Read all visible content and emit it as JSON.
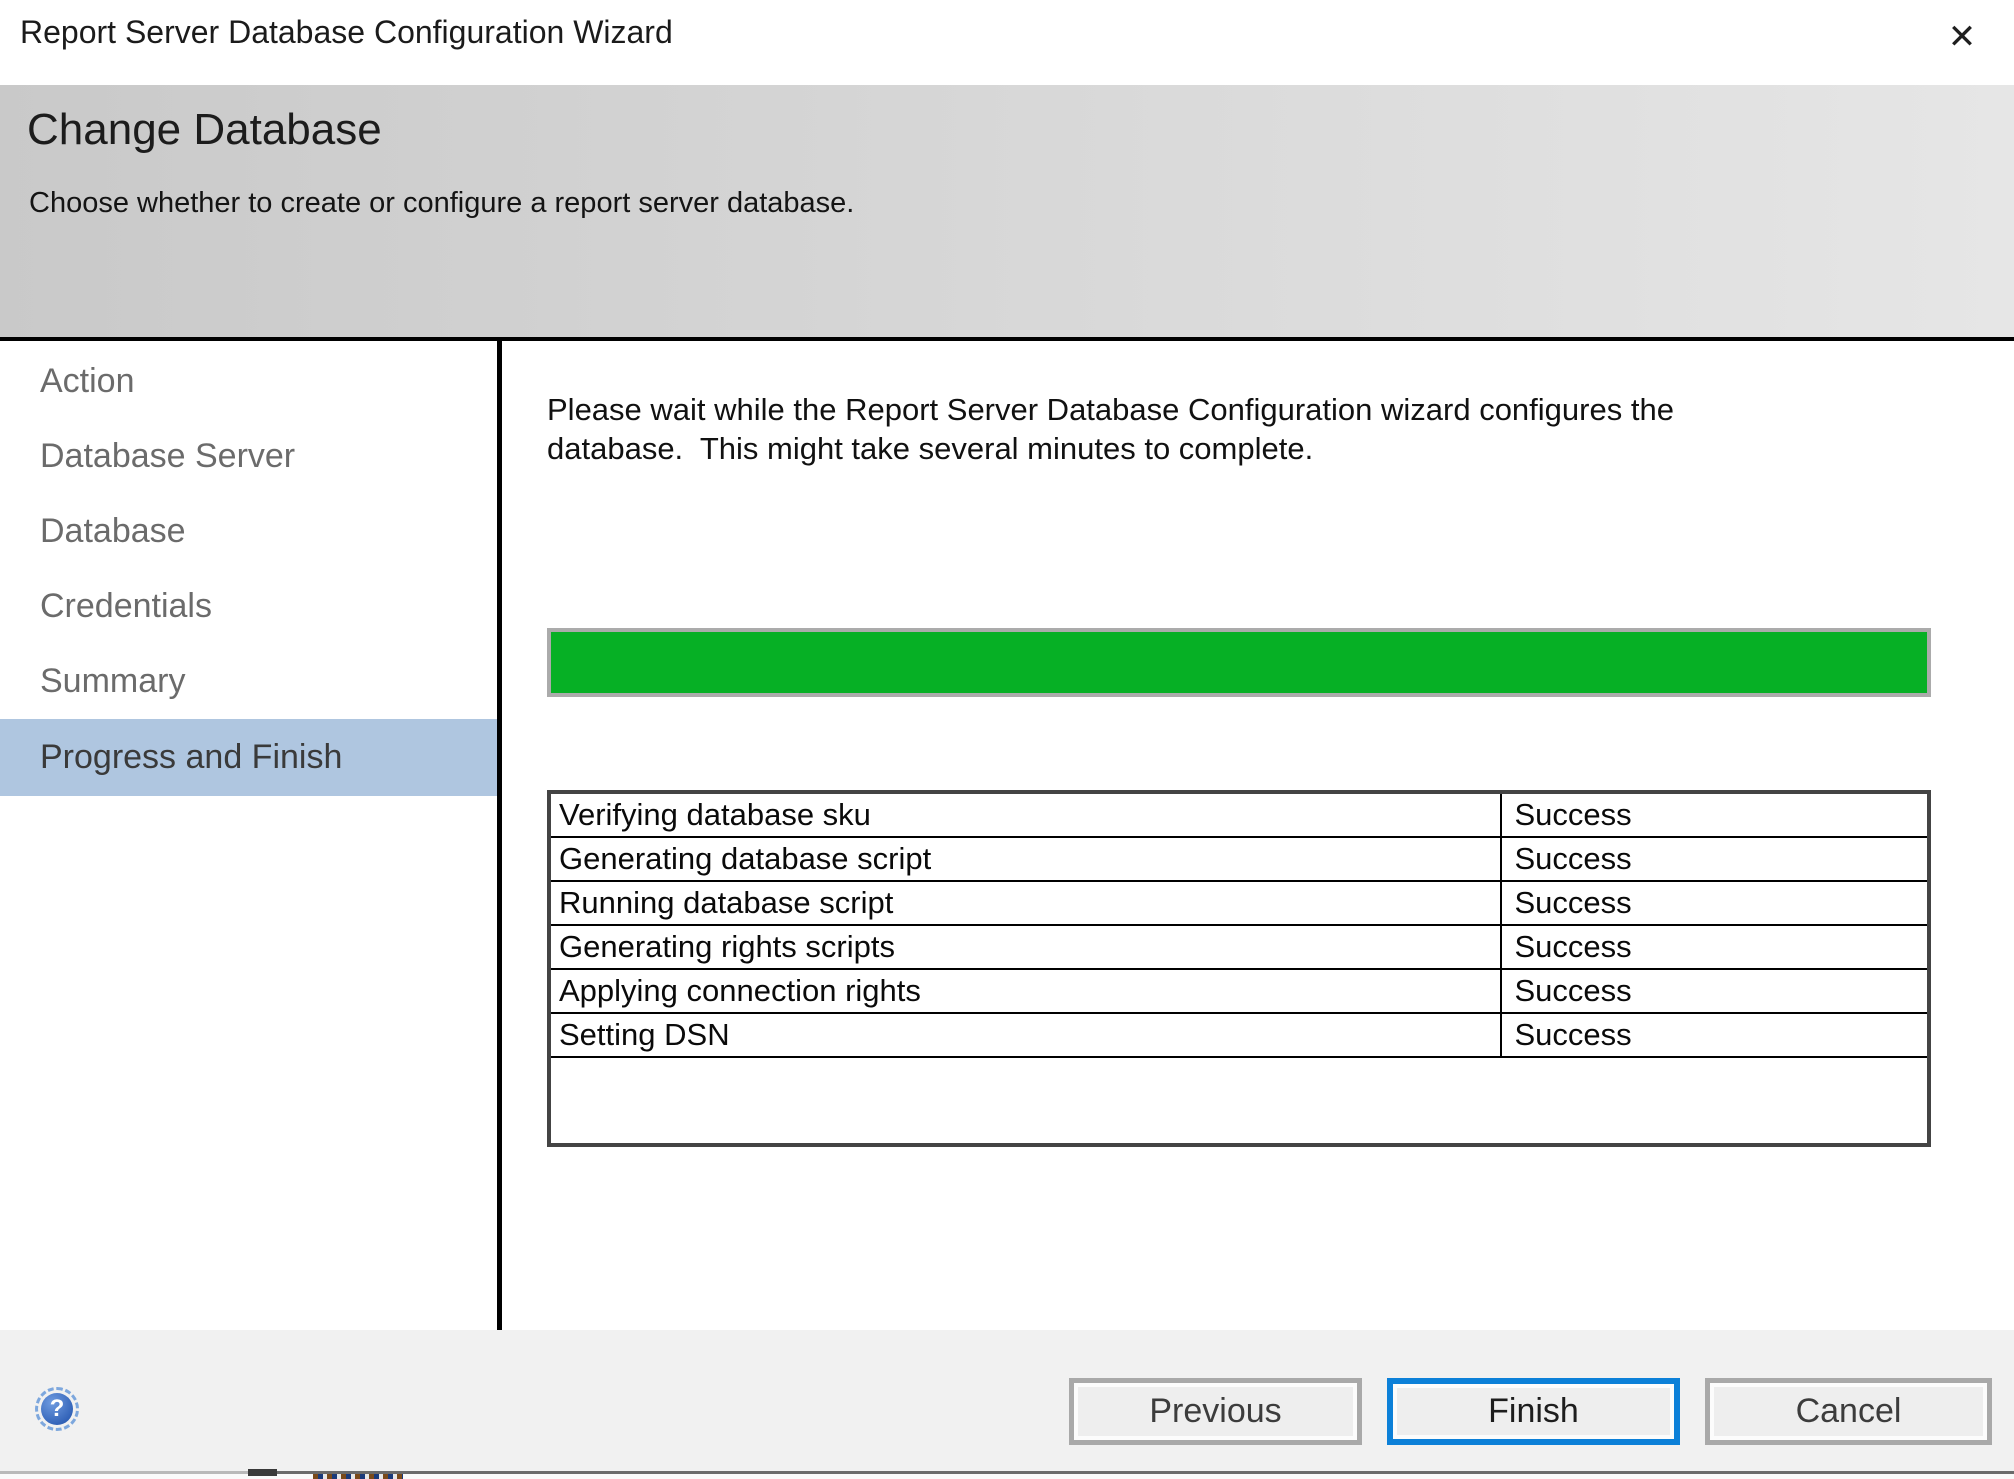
{
  "window": {
    "title": "Report Server Database Configuration Wizard"
  },
  "icons": {
    "close": "✕",
    "help": "?"
  },
  "header": {
    "title": "Change Database",
    "subtitle": "Choose whether to create or configure a report server database."
  },
  "sidebar": {
    "items": [
      {
        "label": "Action",
        "active": false
      },
      {
        "label": "Database Server",
        "active": false
      },
      {
        "label": "Database",
        "active": false
      },
      {
        "label": "Credentials",
        "active": false
      },
      {
        "label": "Summary",
        "active": false
      },
      {
        "label": "Progress and Finish",
        "active": true
      }
    ],
    "active_bg_color": "#afc6e0"
  },
  "main": {
    "message_line1": "Please wait while the Report Server Database Configuration wizard configures the",
    "message_line2": "database.  This might take several minutes to complete.",
    "progress": {
      "percent": 100,
      "fill_color": "#06b025"
    },
    "tasks": [
      {
        "task": "Verifying database sku",
        "status": "Success"
      },
      {
        "task": "Generating database script",
        "status": "Success"
      },
      {
        "task": "Running database script",
        "status": "Success"
      },
      {
        "task": "Generating rights scripts",
        "status": "Success"
      },
      {
        "task": "Applying connection rights",
        "status": "Success"
      },
      {
        "task": "Setting DSN",
        "status": "Success"
      }
    ]
  },
  "footer": {
    "buttons": [
      {
        "label": "Previous",
        "default": false
      },
      {
        "label": "Finish",
        "default": true
      },
      {
        "label": "Cancel",
        "default": false
      }
    ],
    "finish_border_color": "#0c80d8"
  }
}
